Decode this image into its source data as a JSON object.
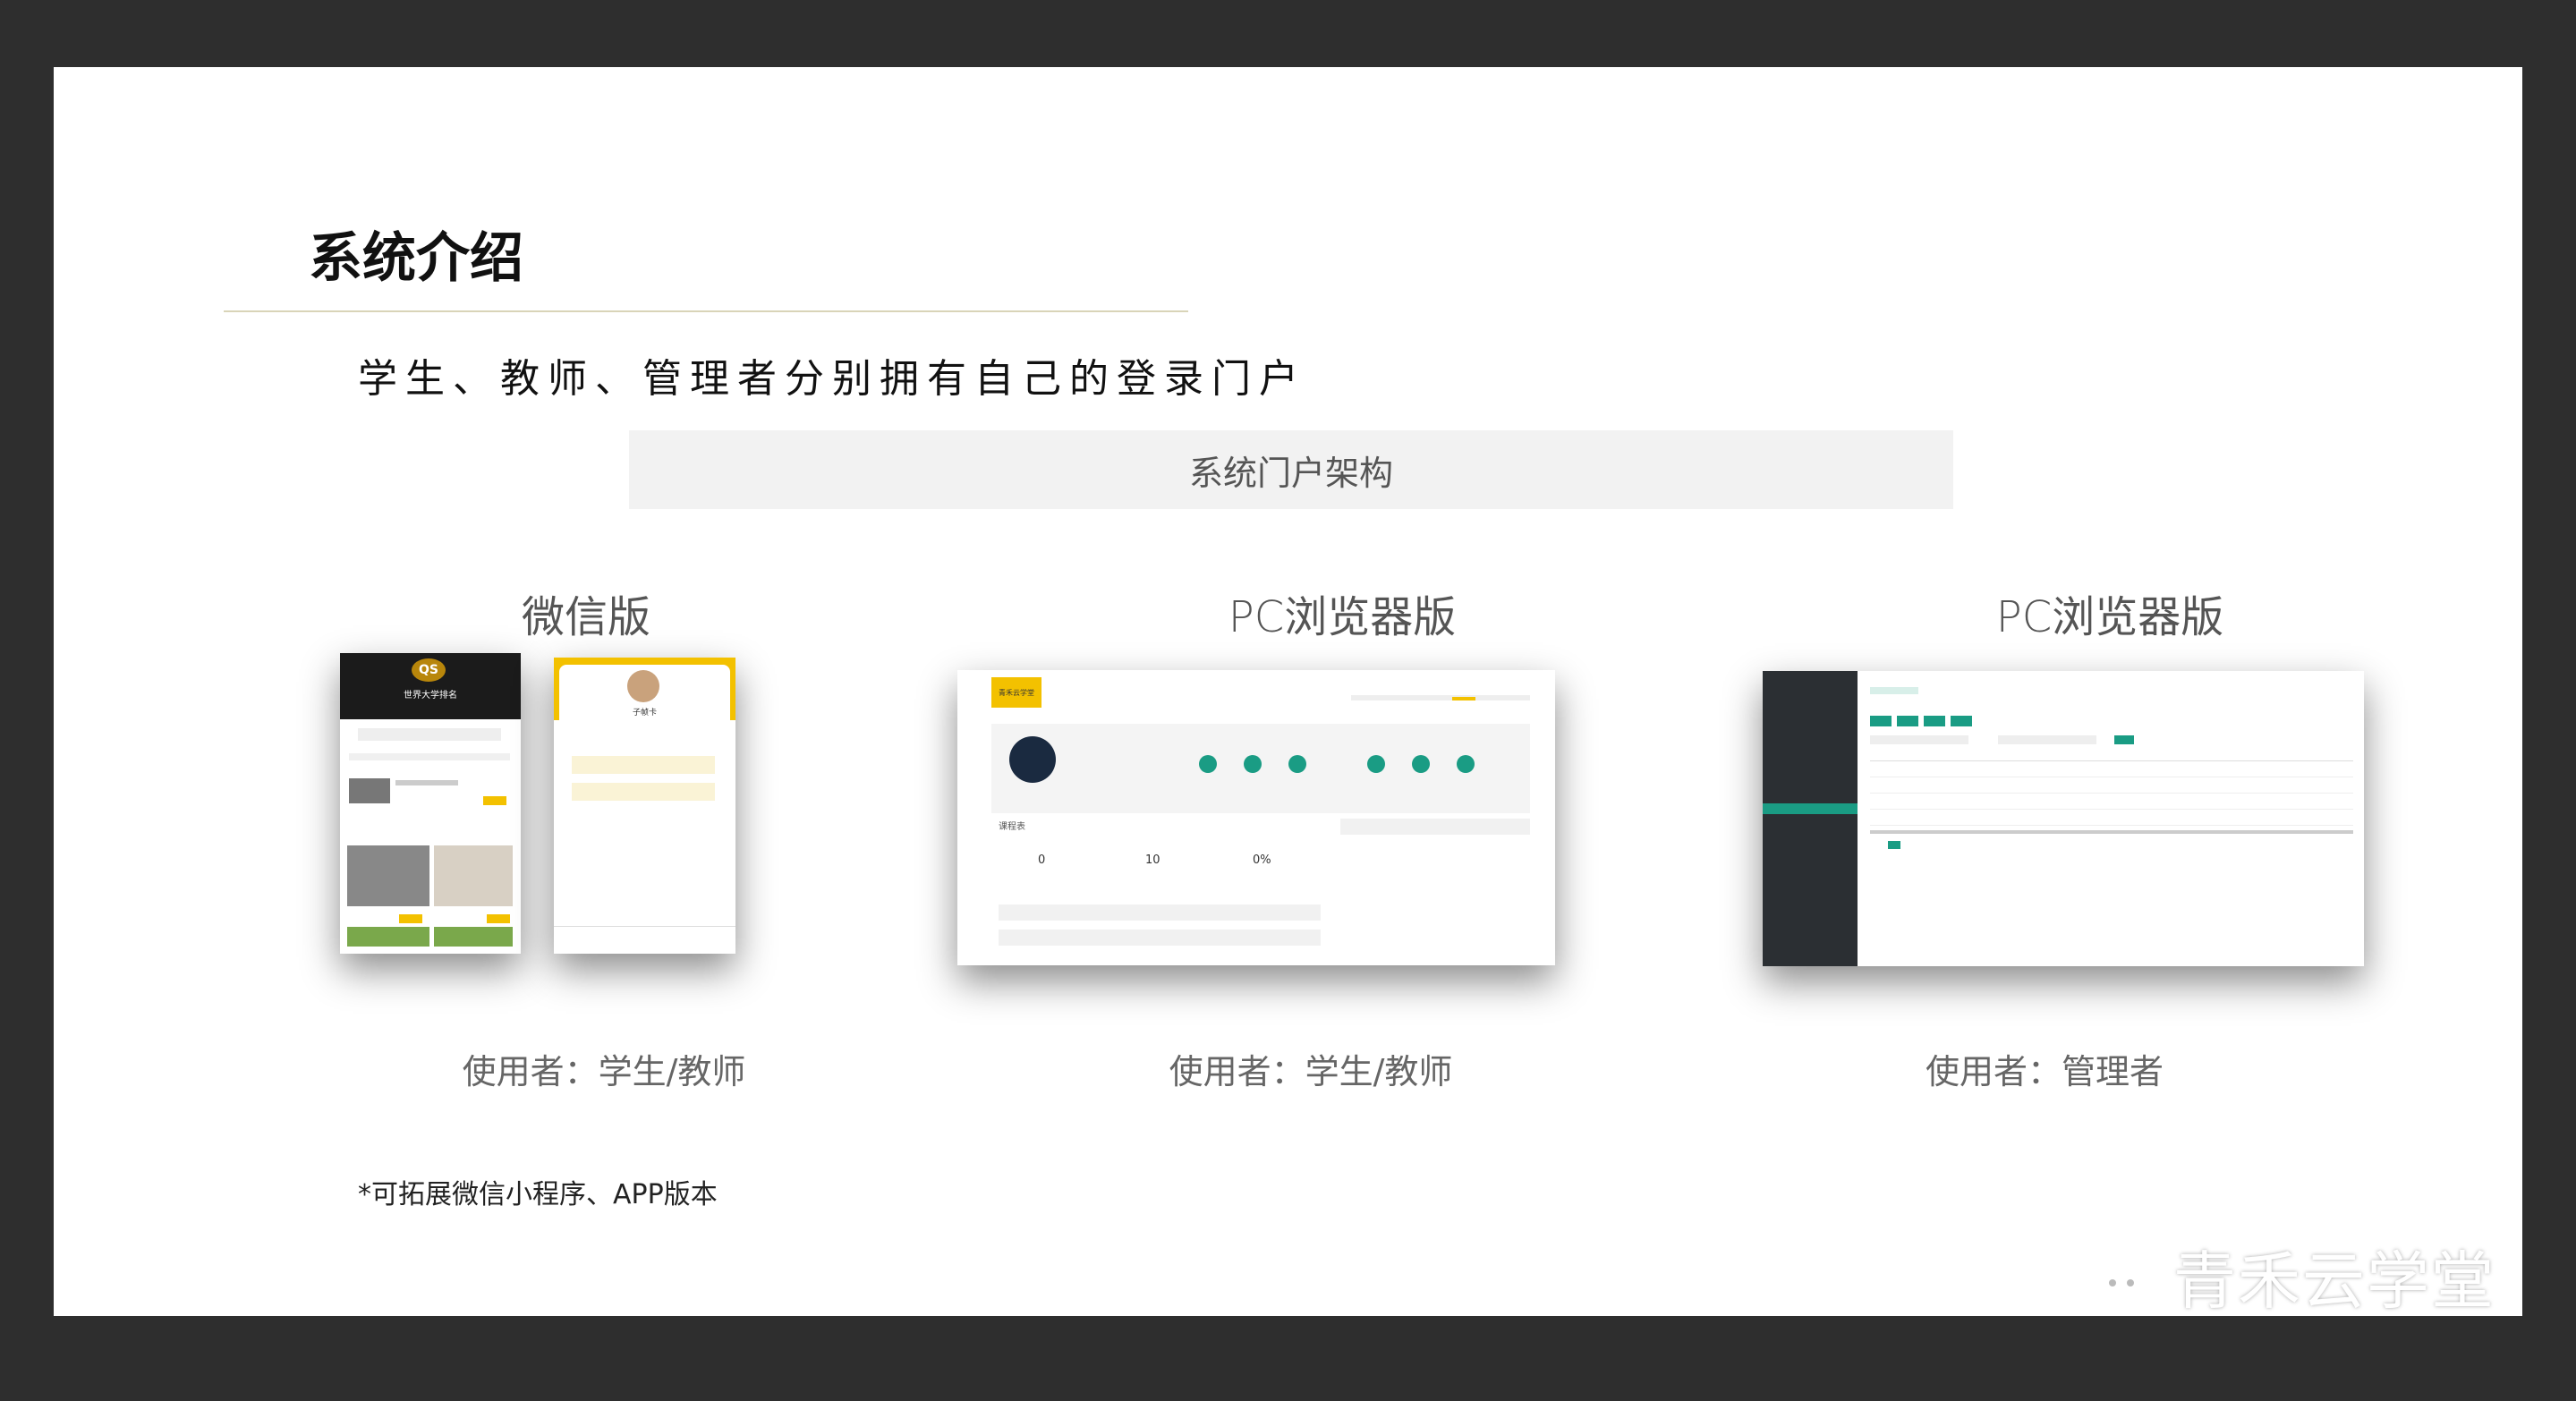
{
  "slide": {
    "title": "系统介绍",
    "subtitle": "学生、教师、管理者分别拥有自己的登录门户",
    "banner": "系统门户架构",
    "footnote": "*可拓展微信小程序、APP版本",
    "watermark": "青禾云学堂"
  },
  "portals": [
    {
      "label": "微信版",
      "users": "使用者：学生/教师"
    },
    {
      "label": "PC浏览器版",
      "users": "使用者：学生/教师"
    },
    {
      "label": "PC浏览器版",
      "users": "使用者：管理者"
    }
  ],
  "mobile": {
    "badge": "QS",
    "banner_text": "世界大学排名",
    "profile_name": "子帧卡"
  },
  "pc_student": {
    "logo": "青禾云学堂",
    "stat_numbers": [
      "0",
      "10",
      "0%"
    ],
    "section_label": "课程表"
  },
  "colors": {
    "accent_yellow": "#f3c100",
    "admin_teal": "#1a9c84",
    "admin_sidebar": "#2b2f33",
    "background_frame": "#2e2e2e"
  },
  "icons": [
    "wechat-icon"
  ]
}
